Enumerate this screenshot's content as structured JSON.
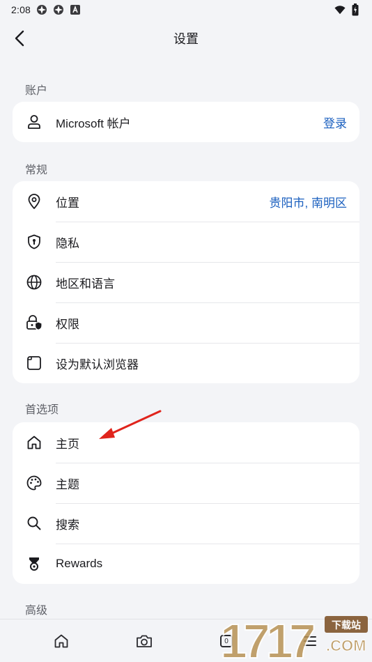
{
  "status_bar": {
    "time": "2:08"
  },
  "header": {
    "title": "设置"
  },
  "sections": [
    {
      "title": "账户",
      "rows": [
        {
          "icon": "person-icon",
          "label": "Microsoft 帐户",
          "value": "登录"
        }
      ]
    },
    {
      "title": "常规",
      "rows": [
        {
          "icon": "location-pin-icon",
          "label": "位置",
          "value": "贵阳市, 南明区"
        },
        {
          "icon": "shield-lock-icon",
          "label": "隐私"
        },
        {
          "icon": "globe-icon",
          "label": "地区和语言"
        },
        {
          "icon": "lock-shield-icon",
          "label": "权限"
        },
        {
          "icon": "browser-window-icon",
          "label": "设为默认浏览器"
        }
      ]
    },
    {
      "title": "首选项",
      "rows": [
        {
          "icon": "home-icon",
          "label": "主页"
        },
        {
          "icon": "palette-icon",
          "label": "主题"
        },
        {
          "icon": "search-icon",
          "label": "搜索"
        },
        {
          "icon": "trophy-icon",
          "label": "Rewards"
        }
      ]
    },
    {
      "title": "高级",
      "rows": []
    }
  ],
  "bottom_nav": {
    "tab_count": "0",
    "items": [
      "home-icon",
      "camera-icon",
      "tabs-icon",
      "menu-icon"
    ]
  },
  "watermark": {
    "text": "17173",
    "badge": "下载站",
    "suffix": ".COM"
  },
  "colors": {
    "accent": "#1a5fbf",
    "background": "#f3f4f7",
    "card": "#ffffff",
    "annotation_arrow": "#e0241c"
  }
}
